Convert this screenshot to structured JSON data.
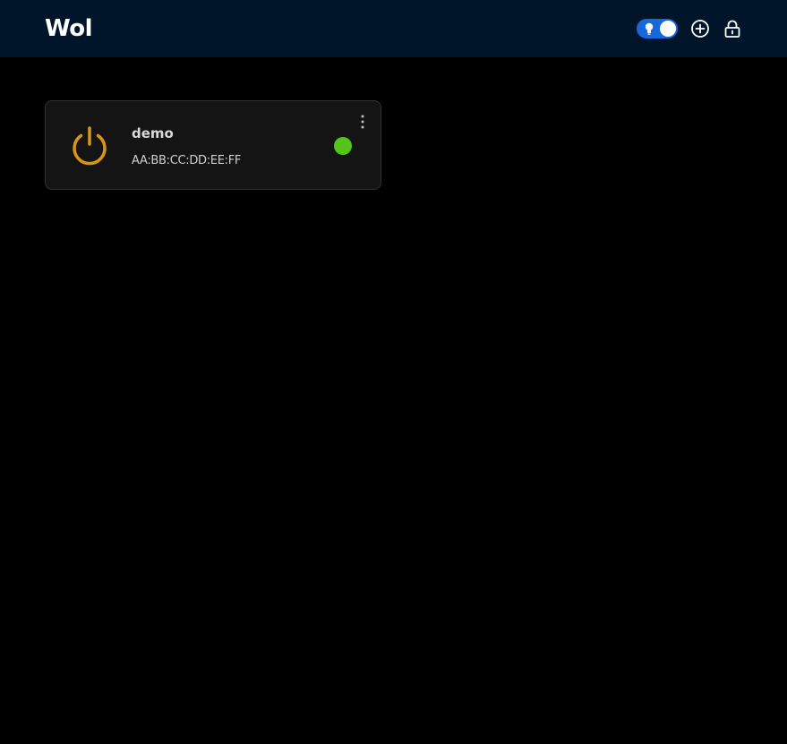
{
  "header": {
    "title": "Wol",
    "background": "#001529",
    "theme_toggle": {
      "state": "on",
      "accent": "#1668dc",
      "icon": "bulb-icon"
    },
    "actions": [
      "plus-circle-icon",
      "lock-icon"
    ]
  },
  "devices": [
    {
      "name": "demo",
      "mac": "AA:BB:CC:DD:EE:FF",
      "status_color": "#52c41a",
      "power_icon_color": "#d89614",
      "menu_icon": "more-vertical-icon"
    }
  ]
}
